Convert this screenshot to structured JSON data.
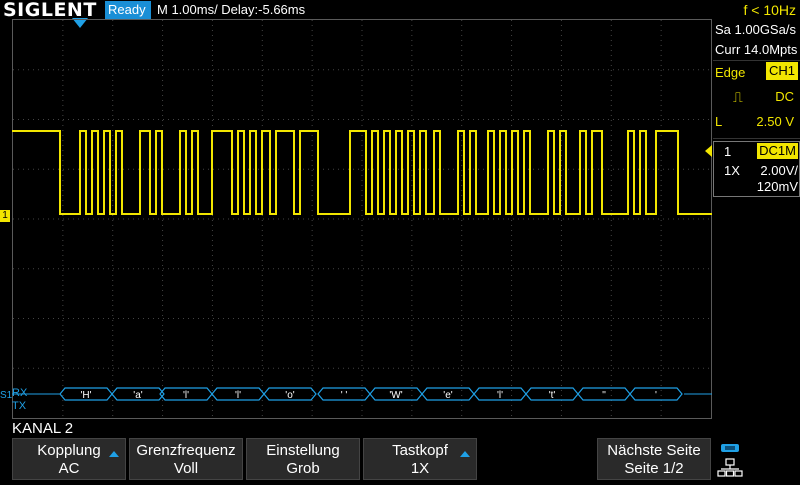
{
  "header": {
    "brand": "SIGLENT",
    "status": "Ready",
    "timebase": "M 1.00ms/ Delay:-5.66ms",
    "frequency": "f < 10Hz"
  },
  "side_panel": {
    "sample_rate": "Sa 1.00GSa/s",
    "memory_depth": "Curr 14.0Mpts",
    "trigger_type_label": "Edge",
    "trigger_source": "CH1",
    "trigger_coupling": "DC",
    "trigger_level_label": "L",
    "trigger_level": "2.50 V",
    "channel_number": "1",
    "channel_coupling": "DC1M",
    "probe_ratio": "1X",
    "volts_per_div": "2.00V/",
    "offset": "120mV"
  },
  "waveform": {
    "channel_marker": "1",
    "serial_marker": "S1",
    "rx_label": "RX",
    "tx_label": "TX",
    "decode_bytes": [
      "'H'",
      "'a'",
      "'l'",
      "'l'",
      "'o'",
      "' '",
      "'W'",
      "'e'",
      "'l'",
      "'t'",
      "''",
      "'"
    ],
    "colors": {
      "trace": "#f2e600",
      "decode": "#1fa0e6",
      "grid": "#5a5a5a"
    }
  },
  "menu": {
    "title": "KANAL 2",
    "buttons": [
      {
        "line1": "Kopplung",
        "line2": "AC"
      },
      {
        "line1": "Grenzfrequenz",
        "line2": "Voll"
      },
      {
        "line1": "Einstellung",
        "line2": "Grob"
      },
      {
        "line1": "Tastkopf",
        "line2": "1X"
      },
      {
        "line1": "Nächste Seite",
        "line2": "Seite 1/2"
      }
    ]
  },
  "icons": [
    "usb-icon",
    "network-icon"
  ]
}
